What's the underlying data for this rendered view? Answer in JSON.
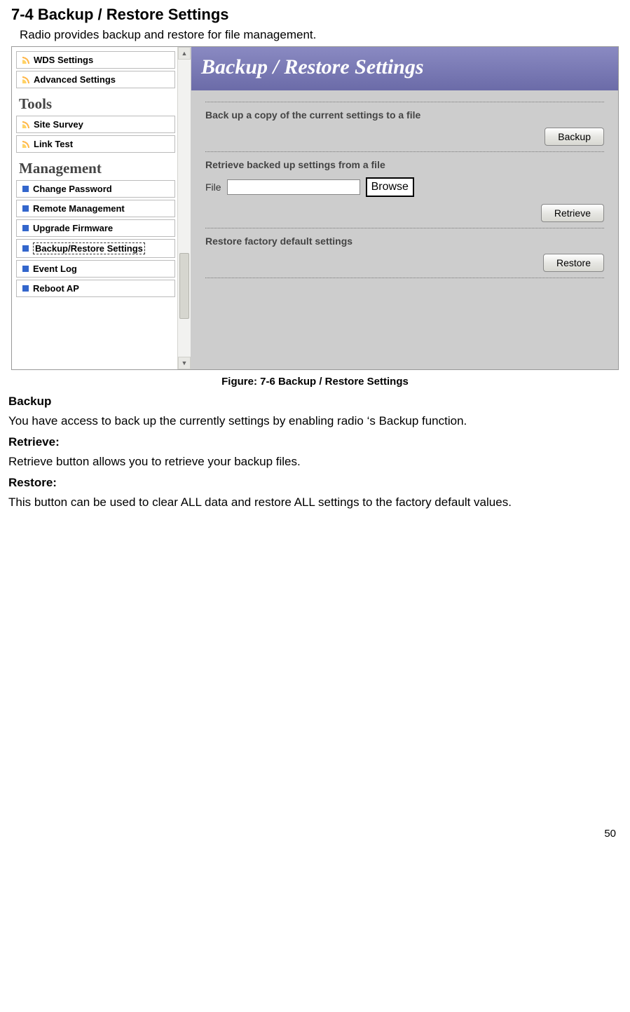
{
  "heading": "7-4    Backup / Restore Settings",
  "intro": "Radio provides backup and restore for file management.",
  "sidebar": {
    "items_top": [
      {
        "label": "WDS Settings"
      },
      {
        "label": "Advanced Settings"
      }
    ],
    "group_tools": "Tools",
    "items_tools": [
      {
        "label": "Site Survey"
      },
      {
        "label": "Link Test"
      }
    ],
    "group_mgmt": "Management",
    "items_mgmt": [
      {
        "label": "Change Password"
      },
      {
        "label": "Remote Management"
      },
      {
        "label": "Upgrade Firmware"
      },
      {
        "label": "Backup/Restore Settings"
      },
      {
        "label": "Event Log"
      },
      {
        "label": "Reboot AP"
      }
    ]
  },
  "main": {
    "title": "Backup / Restore Settings",
    "backup_section": "Back up a copy of the current settings to a file",
    "backup_btn": "Backup",
    "retrieve_section": "Retrieve backed up settings from a file",
    "file_label": "File",
    "browse_btn": "Browse",
    "retrieve_btn": "Retrieve",
    "restore_section": "Restore factory default settings",
    "restore_btn": "Restore"
  },
  "caption": "Figure: 7-6 Backup / Restore Settings",
  "doc": {
    "backup_h": "Backup",
    "backup_p": "You have access to back up the currently settings by enabling radio ‘s Backup function.",
    "retrieve_h": "Retrieve:",
    "retrieve_p": "Retrieve button allows you to retrieve your backup files.",
    "restore_h": "Restore:",
    "restore_p": "This button can be used to clear ALL data and restore ALL settings to the factory default values."
  },
  "page_number": "50"
}
